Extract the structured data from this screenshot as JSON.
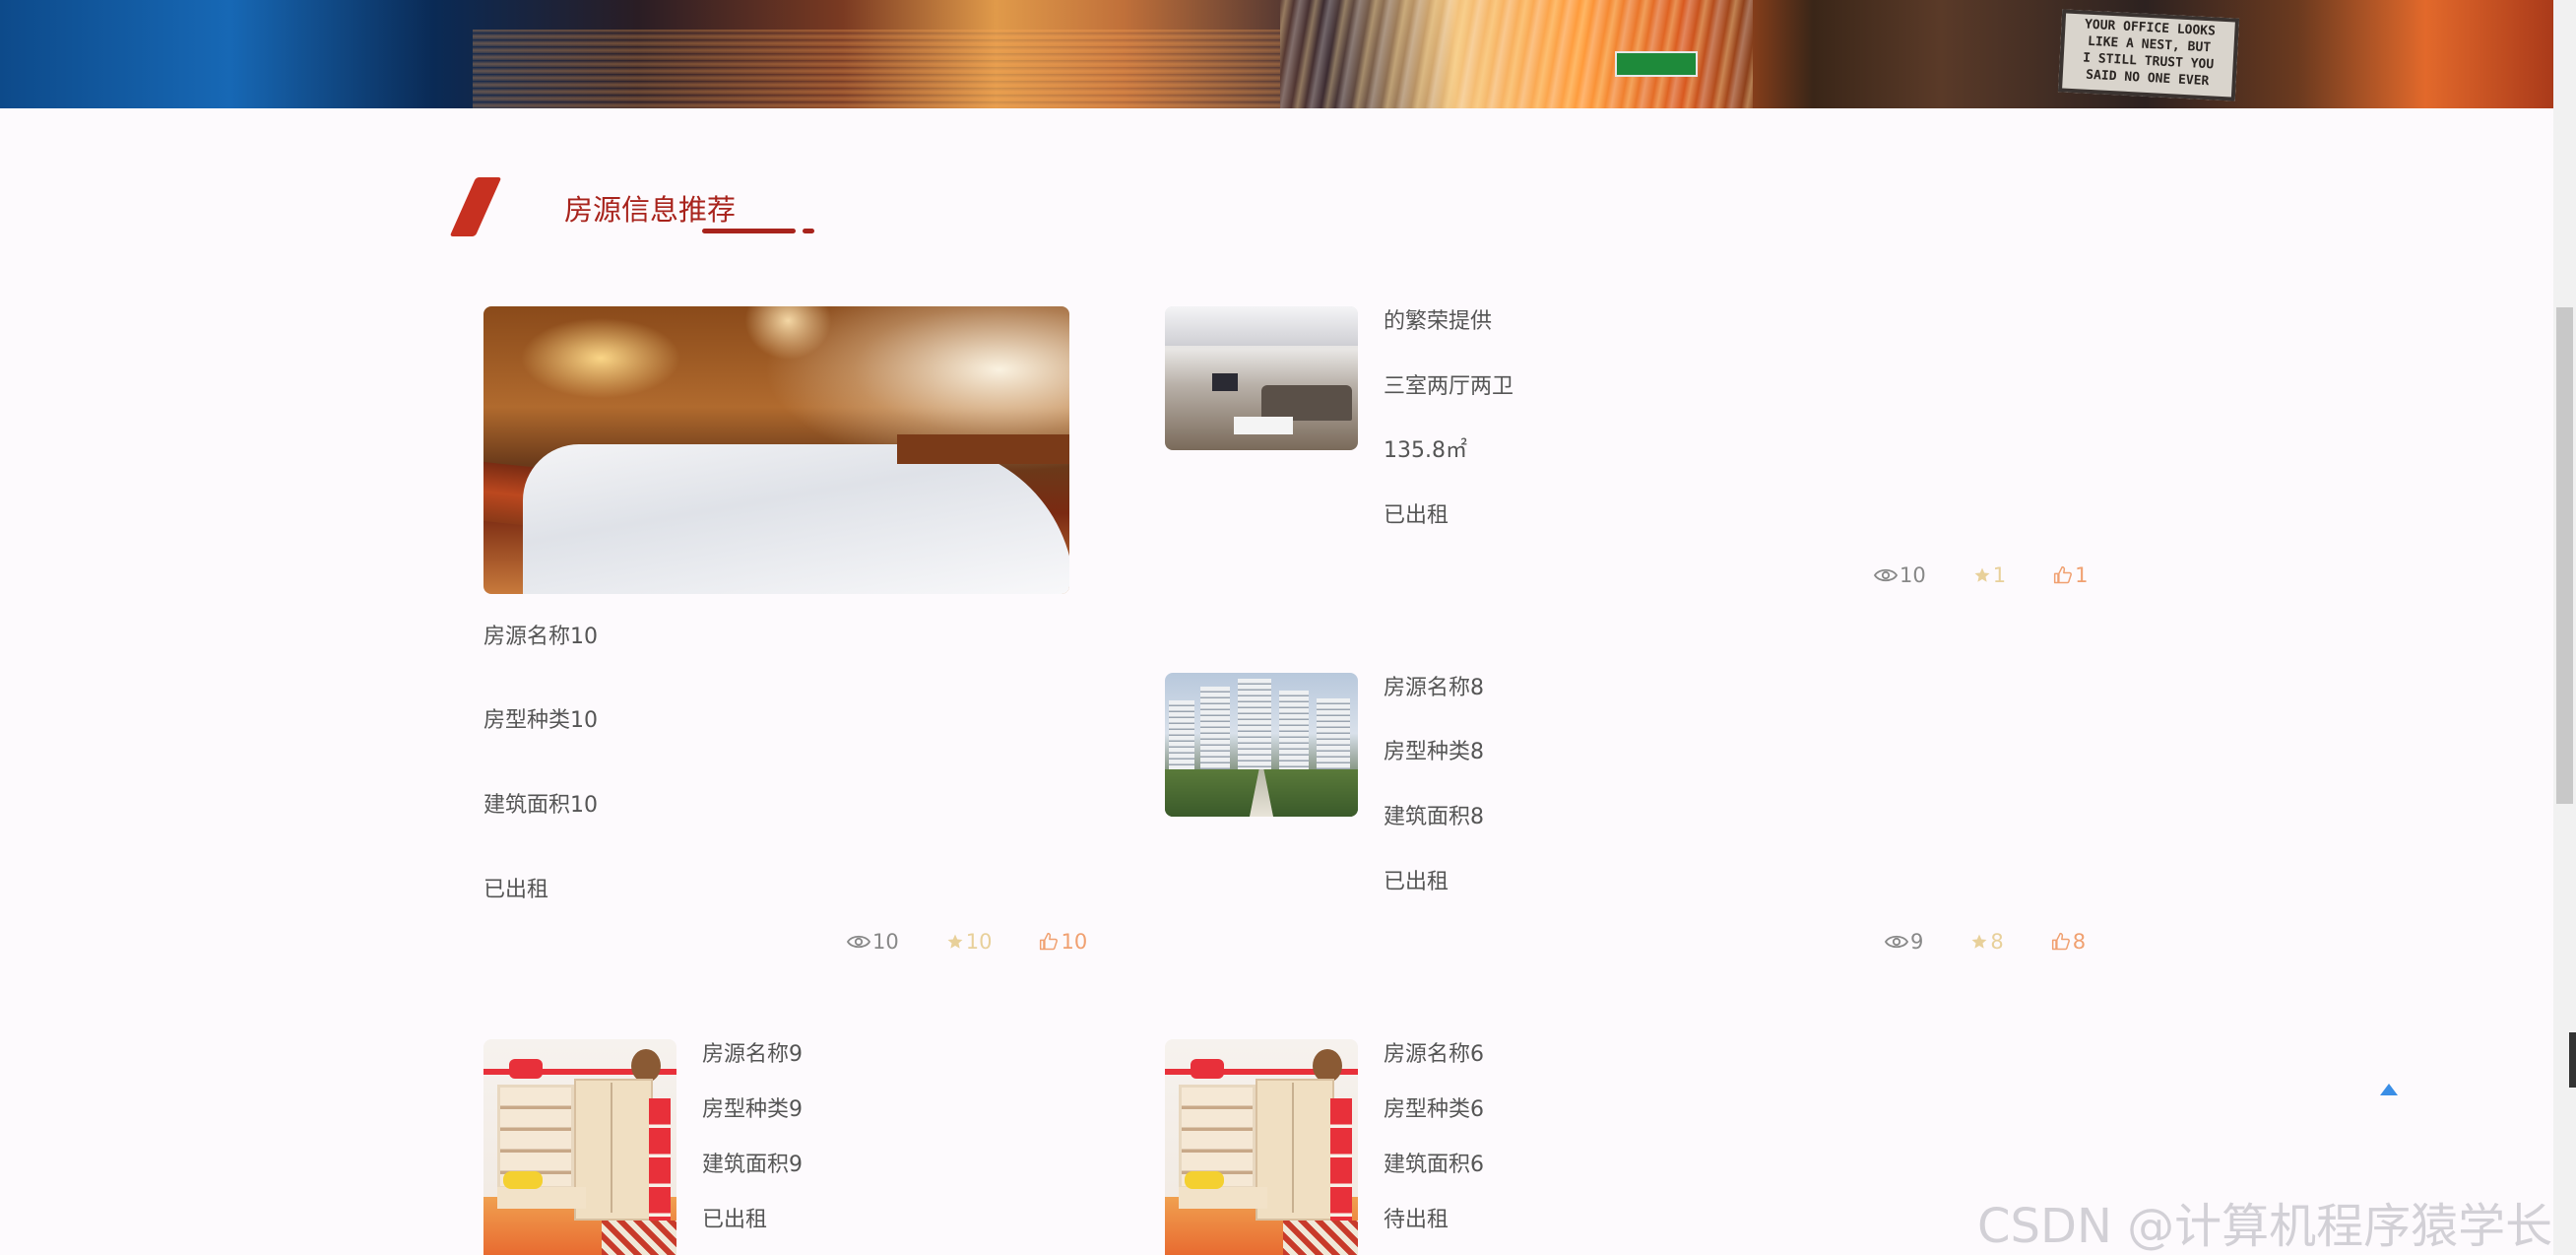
{
  "banner": {
    "sign_text": "YOUR OFFICE LOOKS\nLIKE A NEST, BUT\nI STILL TRUST YOU\nSAID NO ONE EVER"
  },
  "section": {
    "title": "房源信息推荐"
  },
  "listings": [
    {
      "name": "房源名称10",
      "type": "房型种类10",
      "area": "建筑面积10",
      "status": "已出租",
      "views": "10",
      "favorites": "10",
      "likes": "10",
      "image": "bedroom-photo"
    },
    {
      "name": "的繁荣提供",
      "type": "三室两厅两卫",
      "area": "135.8㎡",
      "status": "已出租",
      "views": "10",
      "favorites": "1",
      "likes": "1",
      "image": "living-room-photo"
    },
    {
      "name": "房源名称8",
      "type": "房型种类8",
      "area": "建筑面积8",
      "status": "已出租",
      "views": "9",
      "favorites": "8",
      "likes": "8",
      "image": "apartment-towers-photo"
    },
    {
      "name": "房源名称9",
      "type": "房型种类9",
      "area": "建筑面积9",
      "status": "已出租",
      "image": "kids-room-photo"
    },
    {
      "name": "房源名称6",
      "type": "房型种类6",
      "area": "建筑面积6",
      "status": "待出租",
      "image": "kids-room-photo"
    }
  ],
  "icons": {
    "views": "eye-icon",
    "favorites": "star-icon",
    "likes": "thumbs-up-icon",
    "back_to_top": "triangle-up-icon"
  },
  "colors": {
    "accent": "#a8231c",
    "views": "#888888",
    "favorites": "#e8d09a",
    "likes": "#f0a070",
    "back_to_top": "#3a8ee6"
  },
  "watermark": "CSDN @计算机程序猿学长"
}
